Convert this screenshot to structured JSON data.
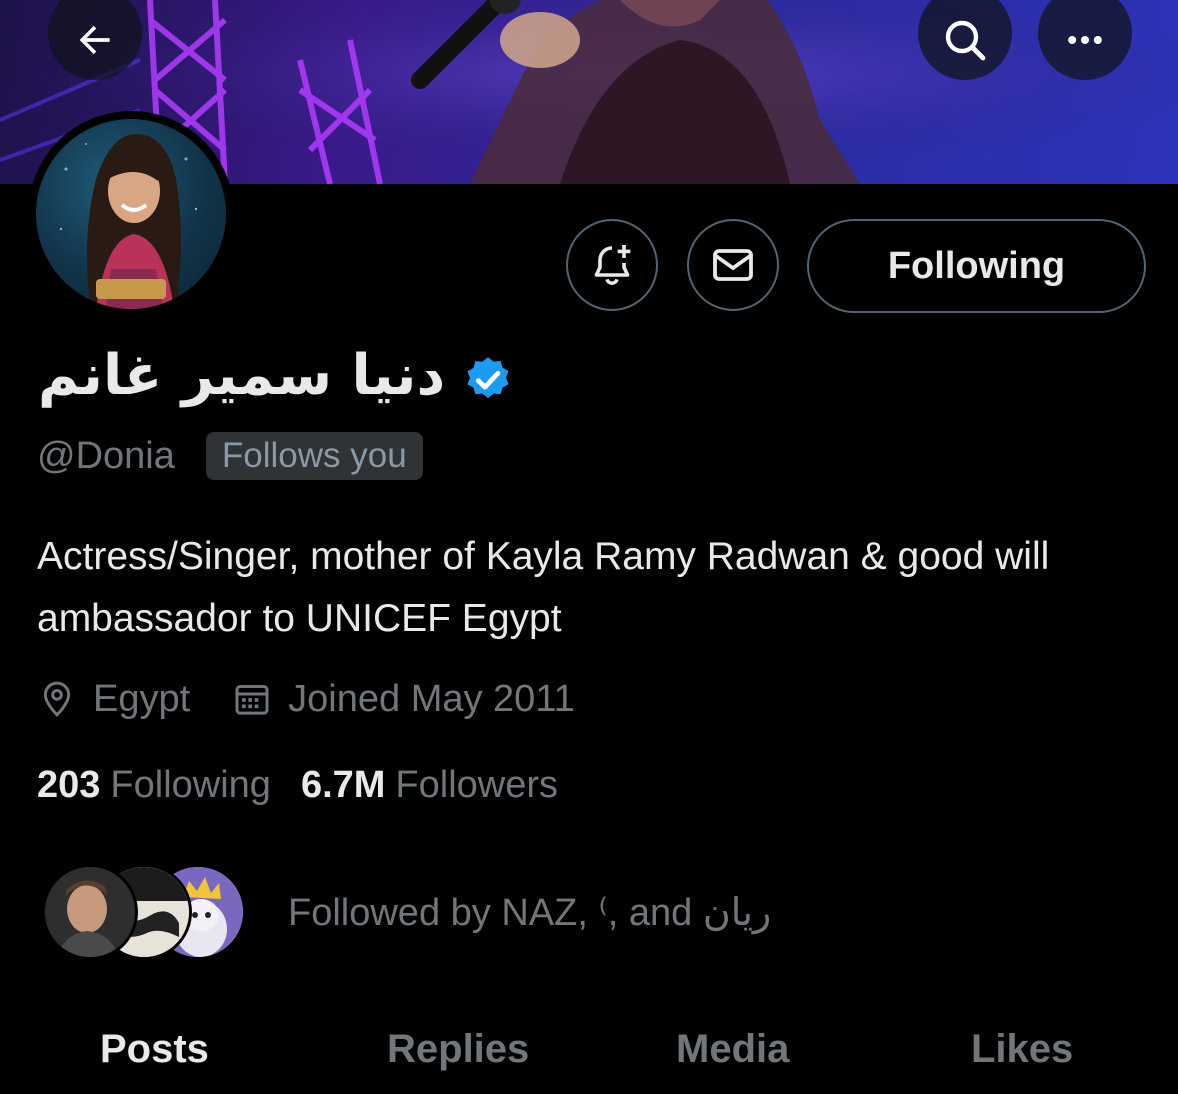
{
  "header": {
    "back_icon": "arrow-left-icon",
    "search_icon": "search-icon",
    "more_icon": "more-horizontal-icon"
  },
  "profile": {
    "display_name": "دنيا سمير غانم",
    "verified": true,
    "verified_color": "#1d9bf0",
    "handle": "@Donia",
    "follows_you": "Follows you",
    "bio": "Actress/Singer, mother of Kayla Ramy Radwan & good will ambassador to UNICEF Egypt",
    "location": "Egypt",
    "joined": "Joined May 2011",
    "following_count": "203",
    "following_label": "Following",
    "followers_count": "6.7M",
    "followers_label": "Followers"
  },
  "actions": {
    "notify_icon": "bell-plus-icon",
    "message_icon": "envelope-icon",
    "following_button": "Following"
  },
  "followed_by": {
    "text": "Followed by NAZ, ⁽, and ريان"
  },
  "tabs": [
    {
      "label": "Posts",
      "active": true
    },
    {
      "label": "Replies",
      "active": false
    },
    {
      "label": "Media",
      "active": false
    },
    {
      "label": "Likes",
      "active": false
    }
  ]
}
